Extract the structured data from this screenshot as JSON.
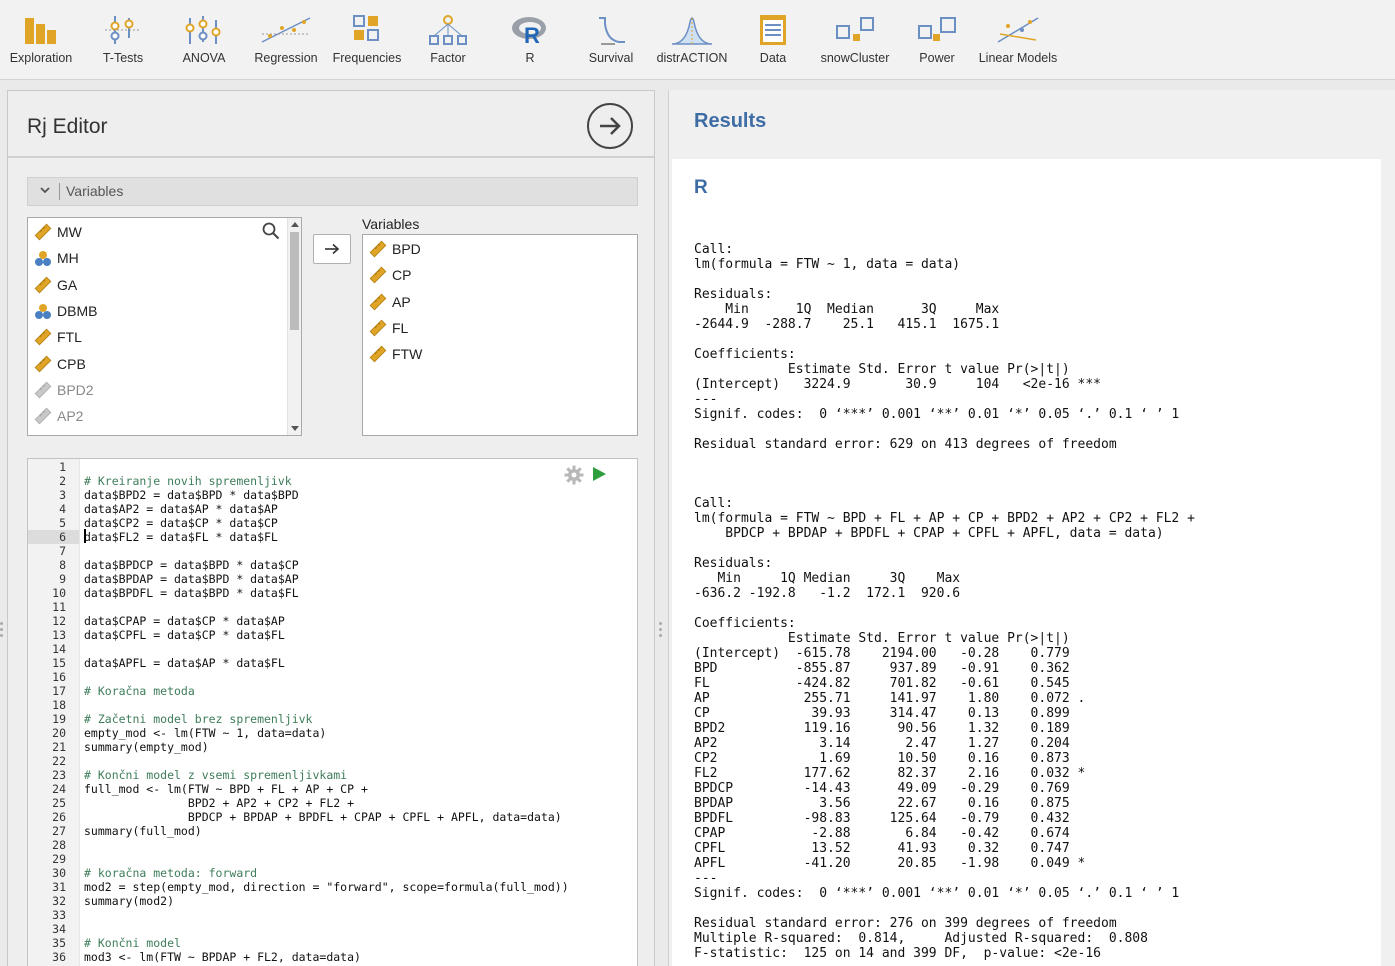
{
  "toolbar": {
    "items": [
      {
        "label": "Exploration",
        "icon": "exploration-icon"
      },
      {
        "label": "T-Tests",
        "icon": "ttests-icon"
      },
      {
        "label": "ANOVA",
        "icon": "anova-icon"
      },
      {
        "label": "Regression",
        "icon": "regression-icon"
      },
      {
        "label": "Frequencies",
        "icon": "frequencies-icon"
      },
      {
        "label": "Factor",
        "icon": "factor-icon"
      },
      {
        "label": "R",
        "icon": "r-icon"
      },
      {
        "label": "Survival",
        "icon": "survival-icon"
      },
      {
        "label": "distrACTION",
        "icon": "distraction-icon"
      },
      {
        "label": "Data",
        "icon": "data-icon"
      },
      {
        "label": "snowCluster",
        "icon": "snowcluster-icon"
      },
      {
        "label": "Power",
        "icon": "power-icon"
      },
      {
        "label": "Linear Models",
        "icon": "linear-models-icon"
      }
    ]
  },
  "editor": {
    "title": "Rj Editor",
    "variables_header": "Variables",
    "available_variables": [
      {
        "name": "MW",
        "type": "continuous"
      },
      {
        "name": "MH",
        "type": "nominal"
      },
      {
        "name": "GA",
        "type": "continuous"
      },
      {
        "name": "DBMB",
        "type": "nominal"
      },
      {
        "name": "FTL",
        "type": "continuous"
      },
      {
        "name": "CPB",
        "type": "continuous"
      },
      {
        "name": "BPD2",
        "type": "computed"
      },
      {
        "name": "AP2",
        "type": "computed"
      }
    ],
    "target_label": "Variables",
    "target_variables": [
      "BPD",
      "CP",
      "AP",
      "FL",
      "FTW"
    ],
    "current_line": 6,
    "code_lines": [
      "",
      "# Kreiranje novih spremenljivk",
      "data$BPD2 = data$BPD * data$BPD",
      "data$AP2 = data$AP * data$AP",
      "data$CP2 = data$CP * data$CP",
      "data$FL2 = data$FL * data$FL",
      "",
      "data$BPDCP = data$BPD * data$CP",
      "data$BPDAP = data$BPD * data$AP",
      "data$BPDFL = data$BPD * data$FL",
      "",
      "data$CPAP = data$CP * data$AP",
      "data$CPFL = data$CP * data$FL",
      "",
      "data$APFL = data$AP * data$FL",
      "",
      "# Koračna metoda",
      "",
      "# Začetni model brez spremenljivk",
      "empty_mod <- lm(FTW ~ 1, data=data)",
      "summary(empty_mod)",
      "",
      "# Končni model z vsemi spremenljivkami",
      "full_mod <- lm(FTW ~ BPD + FL + AP + CP +",
      "               BPD2 + AP2 + CP2 + FL2 +",
      "               BPDCP + BPDAP + BPDFL + CPAP + CPFL + APFL, data=data)",
      "summary(full_mod)",
      "",
      "",
      "# koračna metoda: forward",
      "mod2 = step(empty_mod, direction = \"forward\", scope=formula(full_mod))",
      "summary(mod2)",
      "",
      "",
      "# Končni model",
      "mod3 <- lm(FTW ~ BPDAP + FL2, data=data)"
    ]
  },
  "results": {
    "title": "Results",
    "heading": "R",
    "output_blocks": [
      "Call:\nlm(formula = FTW ~ 1, data = data)\n\nResiduals:\n    Min      1Q  Median      3Q     Max \n-2644.9  -288.7    25.1   415.1  1675.1 \n\nCoefficients:\n            Estimate Std. Error t value Pr(>|t|)    \n(Intercept)   3224.9       30.9     104   <2e-16 ***\n---\nSignif. codes:  0 ‘***’ 0.001 ‘**’ 0.01 ‘*’ 0.05 ‘.’ 0.1 ‘ ’ 1\n\nResidual standard error: 629 on 413 degrees of freedom",
      "Call:\nlm(formula = FTW ~ BPD + FL + AP + CP + BPD2 + AP2 + CP2 + FL2 + \n    BPDCP + BPDAP + BPDFL + CPAP + CPFL + APFL, data = data)\n\nResiduals:\n   Min     1Q Median     3Q    Max \n-636.2 -192.8   -1.2  172.1  920.6 \n\nCoefficients:\n            Estimate Std. Error t value Pr(>|t|)  \n(Intercept)  -615.78    2194.00   -0.28    0.779  \nBPD          -855.87     937.89   -0.91    0.362  \nFL           -424.82     701.82   -0.61    0.545  \nAP            255.71     141.97    1.80    0.072 .\nCP             39.93     314.47    0.13    0.899  \nBPD2          119.16      90.56    1.32    0.189  \nAP2             3.14       2.47    1.27    0.204  \nCP2             1.69      10.50    0.16    0.873  \nFL2           177.62      82.37    2.16    0.032 *\nBPDCP         -14.43      49.09   -0.29    0.769  \nBPDAP           3.56      22.67    0.16    0.875  \nBPDFL         -98.83     125.64   -0.79    0.432  \nCPAP           -2.88       6.84   -0.42    0.674  \nCPFL           13.52      41.93    0.32    0.747  \nAPFL          -41.20      20.85   -1.98    0.049 *\n---\nSignif. codes:  0 ‘***’ 0.001 ‘**’ 0.01 ‘*’ 0.05 ‘.’ 0.1 ‘ ’ 1\n\nResidual standard error: 276 on 399 degrees of freedom\nMultiple R-squared:  0.814,\tAdjusted R-squared:  0.808 \nF-statistic:  125 on 14 and 399 DF,  p-value: <2e-16"
    ]
  },
  "colors": {
    "accent": "#3e6da6",
    "comment": "#3e7d5a",
    "run": "#2e9d3c",
    "ruler_icon": "#e0a526",
    "nominal_icon": "#4a7fc1"
  }
}
